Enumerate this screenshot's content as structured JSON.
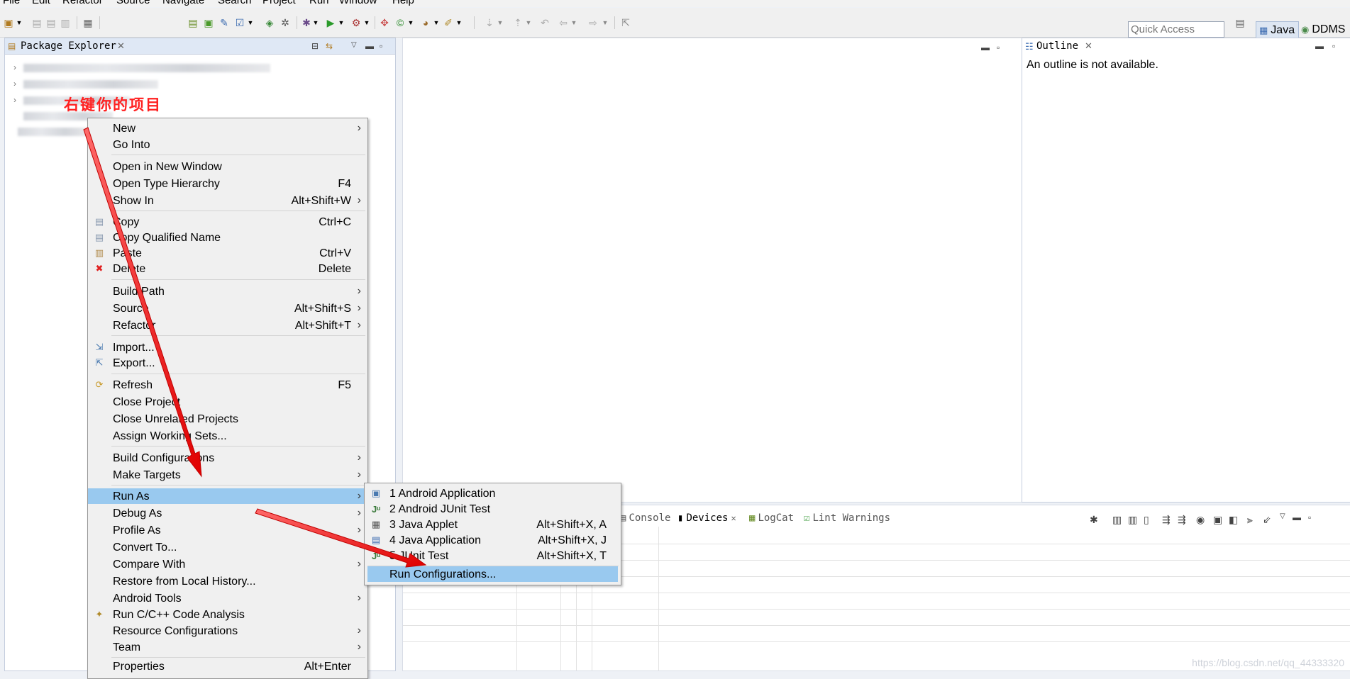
{
  "menubar": [
    "File",
    "Edit",
    "Refactor",
    "Source",
    "Navigate",
    "Search",
    "Project",
    "Run",
    "Window",
    "Help"
  ],
  "quick_access": {
    "placeholder": "Quick Access"
  },
  "perspectives": [
    {
      "label": "Java",
      "icon": "java-perspective-icon",
      "active": true
    },
    {
      "label": "DDMS",
      "icon": "ddms-perspective-icon",
      "active": false
    }
  ],
  "package_explorer": {
    "title": "Package Explorer"
  },
  "outline": {
    "title": "Outline",
    "message": "An outline is not available."
  },
  "bottom_tabs": [
    {
      "label": "Console",
      "icon": "console-icon"
    },
    {
      "label": "Devices",
      "icon": "device-icon",
      "active": true
    },
    {
      "label": "LogCat",
      "icon": "logcat-icon"
    },
    {
      "label": "Lint Warnings",
      "icon": "lint-icon"
    }
  ],
  "annotation": "右键你的项目",
  "context_menu": {
    "items": [
      {
        "label": "New",
        "submenu": true
      },
      {
        "label": "Go Into"
      },
      {
        "label": "Open in New Window"
      },
      {
        "label": "Open Type Hierarchy",
        "accel": "F4"
      },
      {
        "label": "Show In",
        "accel": "Alt+Shift+W",
        "submenu": true
      },
      {
        "label": "Copy",
        "accel": "Ctrl+C",
        "icon": "copy-icon"
      },
      {
        "label": "Copy Qualified Name",
        "icon": "copy-qualified-icon"
      },
      {
        "label": "Paste",
        "accel": "Ctrl+V",
        "icon": "paste-icon"
      },
      {
        "label": "Delete",
        "accel": "Delete",
        "icon": "delete-icon"
      },
      {
        "label": "Build Path",
        "submenu": true
      },
      {
        "label": "Source",
        "accel": "Alt+Shift+S",
        "submenu": true
      },
      {
        "label": "Refactor",
        "accel": "Alt+Shift+T",
        "submenu": true
      },
      {
        "label": "Import...",
        "icon": "import-icon"
      },
      {
        "label": "Export...",
        "icon": "export-icon"
      },
      {
        "label": "Refresh",
        "accel": "F5",
        "icon": "refresh-icon"
      },
      {
        "label": "Close Project"
      },
      {
        "label": "Close Unrelated Projects"
      },
      {
        "label": "Assign Working Sets..."
      },
      {
        "label": "Build Configurations",
        "submenu": true
      },
      {
        "label": "Make Targets",
        "submenu": true
      },
      {
        "label": "Run As",
        "submenu": true,
        "selected": true
      },
      {
        "label": "Debug As",
        "submenu": true
      },
      {
        "label": "Profile As",
        "submenu": true
      },
      {
        "label": "Convert To..."
      },
      {
        "label": "Compare With",
        "submenu": true
      },
      {
        "label": "Restore from Local History..."
      },
      {
        "label": "Android Tools",
        "submenu": true
      },
      {
        "label": "Run C/C++ Code Analysis",
        "icon": "code-analysis-icon"
      },
      {
        "label": "Resource Configurations",
        "submenu": true
      },
      {
        "label": "Team",
        "submenu": true
      },
      {
        "label": "Properties",
        "accel": "Alt+Enter"
      }
    ]
  },
  "run_as_submenu": {
    "items": [
      {
        "label": "1 Android Application",
        "icon": "android-app-icon"
      },
      {
        "label": "2 Android JUnit Test",
        "icon": "junit-icon"
      },
      {
        "label": "3 Java Applet",
        "accel": "Alt+Shift+X, A",
        "icon": "applet-icon"
      },
      {
        "label": "4 Java Application",
        "accel": "Alt+Shift+X, J",
        "icon": "java-app-icon"
      },
      {
        "label": "5 JUnit Test",
        "accel": "Alt+Shift+X, T",
        "icon": "junit-test-icon"
      },
      {
        "label": "Run Configurations...",
        "selected": true
      }
    ]
  },
  "watermark": "https://blog.csdn.net/qq_44333320",
  "colors": {
    "selection": "#99c9ef",
    "arrow": "#ff1a1a",
    "panel_border": "#c5cede"
  }
}
